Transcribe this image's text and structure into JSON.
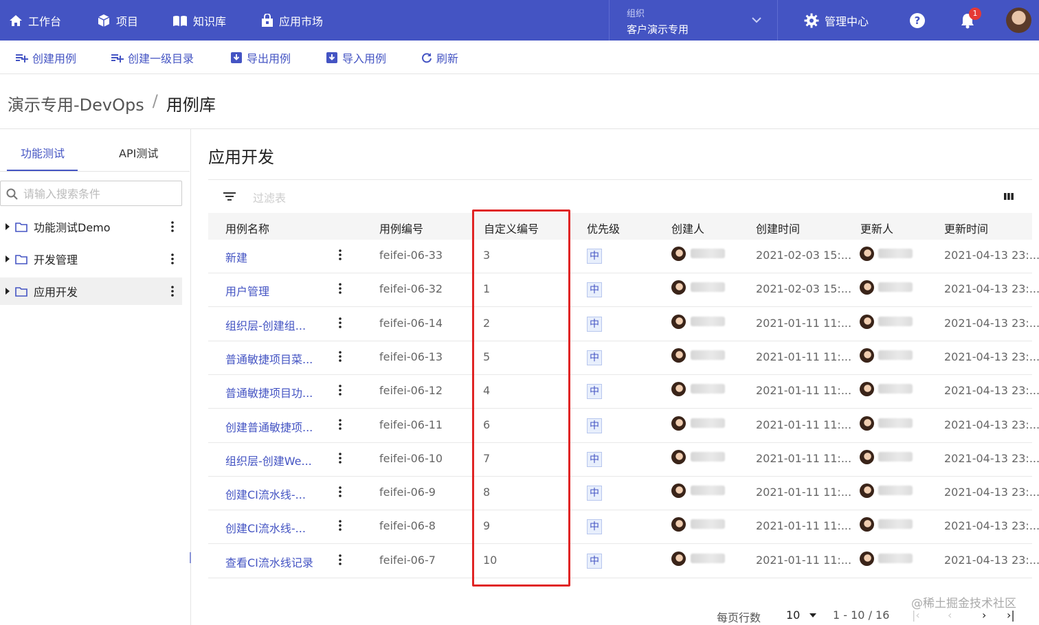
{
  "topnav": {
    "items": [
      {
        "label": "工作台",
        "icon": "home-icon"
      },
      {
        "label": "项目",
        "icon": "cube-icon"
      },
      {
        "label": "知识库",
        "icon": "book-icon"
      },
      {
        "label": "应用市场",
        "icon": "store-icon"
      }
    ],
    "org_label": "组织",
    "org_name": "客户演示专用",
    "admin_label": "管理中心",
    "help": "?",
    "notification_count": "1",
    "colors": {
      "bar": "#4454c3",
      "badge": "#e53935"
    }
  },
  "toolbar": {
    "create_case": "创建用例",
    "create_dir": "创建一级目录",
    "export": "导出用例",
    "import": "导入用例",
    "refresh": "刷新"
  },
  "breadcrumb": {
    "project": "演示专用-DevOps",
    "separator": "/",
    "current": "用例库"
  },
  "sidebar": {
    "tabs": [
      "功能测试",
      "API测试"
    ],
    "active_tab": "功能测试",
    "search_placeholder": "请输入搜索条件",
    "tree": [
      {
        "label": "功能测试Demo",
        "selected": false
      },
      {
        "label": "开发管理",
        "selected": false
      },
      {
        "label": "应用开发",
        "selected": true
      }
    ]
  },
  "main": {
    "title": "应用开发",
    "filter_placeholder": "过滤表"
  },
  "table": {
    "columns": [
      "用例名称",
      "用例编号",
      "自定义编号",
      "优先级",
      "创建人",
      "创建时间",
      "更新人",
      "更新时间"
    ],
    "rows": [
      {
        "name": "新建",
        "code": "feifei-06-33",
        "custom": "3",
        "priority": "中",
        "created": "2021-02-03 15:...",
        "updated": "2021-04-13 23:..."
      },
      {
        "name": "用户管理",
        "code": "feifei-06-32",
        "custom": "1",
        "priority": "中",
        "created": "2021-02-03 15:...",
        "updated": "2021-04-13 23:..."
      },
      {
        "name": "组织层-创建组...",
        "code": "feifei-06-14",
        "custom": "2",
        "priority": "中",
        "created": "2021-01-11 11:...",
        "updated": "2021-04-13 23:..."
      },
      {
        "name": "普通敏捷项目菜...",
        "code": "feifei-06-13",
        "custom": "5",
        "priority": "中",
        "created": "2021-01-11 11:...",
        "updated": "2021-04-13 23:..."
      },
      {
        "name": "普通敏捷项目功...",
        "code": "feifei-06-12",
        "custom": "4",
        "priority": "中",
        "created": "2021-01-11 11:...",
        "updated": "2021-04-13 23:..."
      },
      {
        "name": "创建普通敏捷项...",
        "code": "feifei-06-11",
        "custom": "6",
        "priority": "中",
        "created": "2021-01-11 11:...",
        "updated": "2021-04-13 23:..."
      },
      {
        "name": "组织层-创建We...",
        "code": "feifei-06-10",
        "custom": "7",
        "priority": "中",
        "created": "2021-01-11 11:...",
        "updated": "2021-04-13 23:..."
      },
      {
        "name": "创建CI流水线-...",
        "code": "feifei-06-9",
        "custom": "8",
        "priority": "中",
        "created": "2021-01-11 11:...",
        "updated": "2021-04-13 23:..."
      },
      {
        "name": "创建CI流水线-...",
        "code": "feifei-06-8",
        "custom": "9",
        "priority": "中",
        "created": "2021-01-11 11:...",
        "updated": "2021-04-13 23:..."
      },
      {
        "name": "查看CI流水线记录",
        "code": "feifei-06-7",
        "custom": "10",
        "priority": "中",
        "created": "2021-01-11 11:...",
        "updated": "2021-04-13 23:..."
      }
    ],
    "highlight_color": "#e02424"
  },
  "pagination": {
    "rows_per_page_label": "每页行数",
    "rows_per_page": "10",
    "range": "1 - 10 / 16"
  },
  "watermark": "@稀土掘金技术社区"
}
